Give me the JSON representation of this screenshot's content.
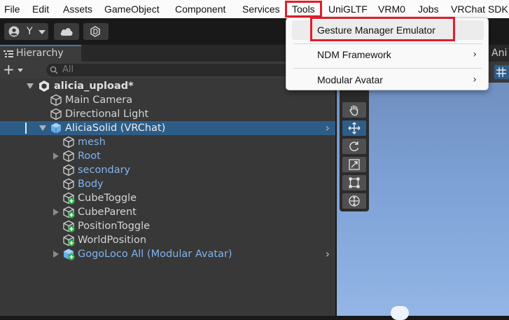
{
  "menubar": {
    "items": [
      "File",
      "Edit",
      "Assets",
      "GameObject",
      "Component",
      "Services",
      "Tools",
      "UniGLTF",
      "VRM0",
      "Jobs",
      "VRChat SDK"
    ],
    "active": "Tools"
  },
  "toolbar": {
    "account_label": "Y",
    "icons": [
      "account-icon",
      "cloud-icon",
      "unity-version-control-icon"
    ]
  },
  "hierarchy": {
    "tab_label": "Hierarchy",
    "search_placeholder": "All",
    "scene_name": "alicia_upload*",
    "rows": [
      {
        "label": "Main Camera",
        "style": "normal",
        "icon": "gameobject-icon"
      },
      {
        "label": "Directional Light",
        "style": "normal",
        "icon": "gameobject-icon"
      },
      {
        "label": "AliciaSolid (VRChat)",
        "style": "selected",
        "icon": "prefab-icon",
        "expanded": true
      },
      {
        "label": "mesh",
        "style": "blue",
        "icon": "gameobject-icon"
      },
      {
        "label": "Root",
        "style": "blue",
        "icon": "gameobject-icon",
        "collapsed": true
      },
      {
        "label": "secondary",
        "style": "blue",
        "icon": "gameobject-icon"
      },
      {
        "label": "Body",
        "style": "blue",
        "icon": "gameobject-icon"
      },
      {
        "label": "CubeToggle",
        "style": "normal",
        "icon": "gameobject-added-icon"
      },
      {
        "label": "CubeParent",
        "style": "normal",
        "icon": "gameobject-added-icon",
        "collapsed": true
      },
      {
        "label": "PositionToggle",
        "style": "normal",
        "icon": "gameobject-added-icon"
      },
      {
        "label": "WorldPosition",
        "style": "normal",
        "icon": "gameobject-added-icon"
      },
      {
        "label": "GogoLoco All (Modular Avatar)",
        "style": "blue",
        "icon": "prefab-added-icon",
        "collapsed": true
      }
    ]
  },
  "scene_panel": {
    "tab_label_partial": "Ani",
    "tools": [
      "hand-tool-icon",
      "move-tool-icon",
      "rotate-tool-icon",
      "scale-tool-icon",
      "rect-tool-icon",
      "transform-tool-icon"
    ],
    "active_tool": "move-tool-icon"
  },
  "tools_menu": {
    "items": [
      {
        "label": "Gesture Manager Emulator",
        "submenu": false,
        "highlighted": true
      },
      {
        "label": "NDM Framework",
        "submenu": true
      },
      {
        "label": "Modular Avatar",
        "submenu": true
      }
    ]
  },
  "colors": {
    "highlight_box": "#e11d2b",
    "selection": "#2c5d87",
    "prefab_text": "#7fb4f0"
  }
}
